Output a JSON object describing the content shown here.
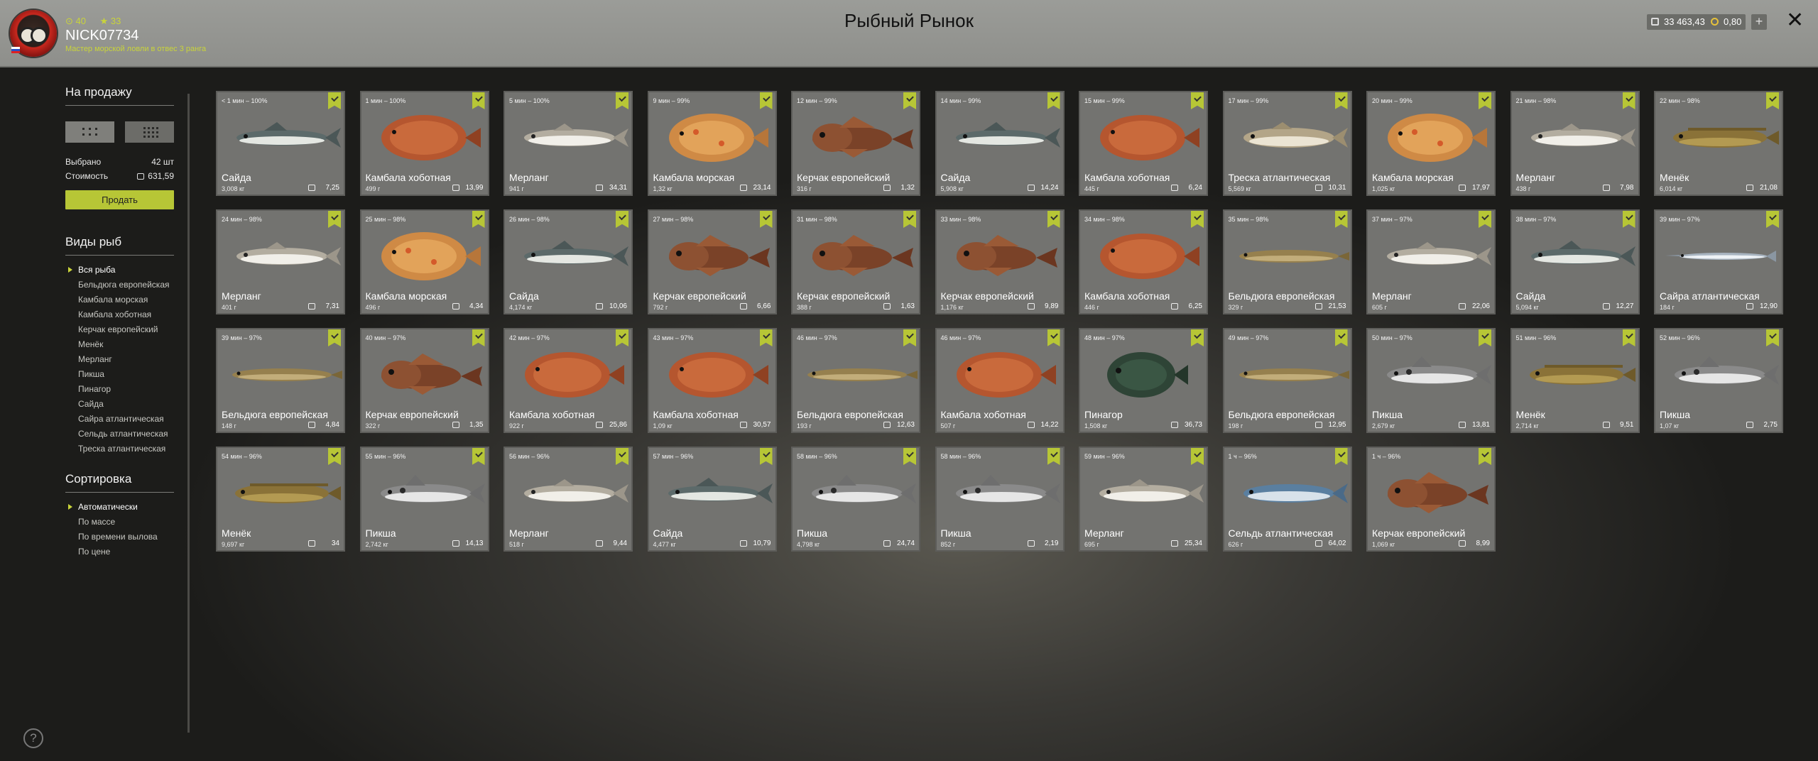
{
  "header": {
    "title": "Рыбный Рынок",
    "player": {
      "nick": "NICK07734",
      "rank": "Мастер морской ловли в отвес 3 ранга",
      "stat1": "40",
      "stat2": "33"
    },
    "silver": "33 463,43",
    "gold": "0,80",
    "plus_label": "+",
    "close_label": "✕"
  },
  "sidebar": {
    "for_sale_title": "На продажу",
    "selected_label": "Выбрано",
    "selected_value": "42 шт",
    "cost_label": "Стоимость",
    "cost_value": "631,59",
    "sell_button": "Продать",
    "species_title": "Виды рыб",
    "species": [
      "Вся рыба",
      "Бельдюга европейская",
      "Камбала морская",
      "Камбала хоботная",
      "Керчак европейский",
      "Менёк",
      "Мерланг",
      "Пикша",
      "Пинагор",
      "Сайда",
      "Сайра атлантическая",
      "Сельдь атлантическая",
      "Треска атлантическая"
    ],
    "sort_title": "Сортировка",
    "sort": [
      "Автоматически",
      "По массе",
      "По времени вылова",
      "По цене"
    ],
    "help_label": "?"
  },
  "colors": {
    "accent": "#b7c636",
    "header": "#9b9c98",
    "card": "#737370"
  },
  "fish": [
    {
      "time": "< 1 мин – 100%",
      "name": "Сайда",
      "weight": "3,008 кг",
      "price": "7,25",
      "kind": "pollock"
    },
    {
      "time": "1 мин – 100%",
      "name": "Камбала хоботная",
      "weight": "499 г",
      "price": "13,99",
      "kind": "flatfish"
    },
    {
      "time": "5 мин – 100%",
      "name": "Мерланг",
      "weight": "941 г",
      "price": "34,31",
      "kind": "whiting"
    },
    {
      "time": "9 мин – 99%",
      "name": "Камбала морская",
      "weight": "1,32 кг",
      "price": "23,14",
      "kind": "plaice"
    },
    {
      "time": "12 мин – 99%",
      "name": "Керчак европейский",
      "weight": "316 г",
      "price": "1,32",
      "kind": "sculpin"
    },
    {
      "time": "14 мин – 99%",
      "name": "Сайда",
      "weight": "5,908 кг",
      "price": "14,24",
      "kind": "pollock"
    },
    {
      "time": "15 мин – 99%",
      "name": "Камбала хоботная",
      "weight": "445 г",
      "price": "6,24",
      "kind": "flatfish"
    },
    {
      "time": "17 мин – 99%",
      "name": "Треска атлантическая",
      "weight": "5,569 кг",
      "price": "10,31",
      "kind": "cod"
    },
    {
      "time": "20 мин – 99%",
      "name": "Камбала морская",
      "weight": "1,025 кг",
      "price": "17,97",
      "kind": "plaice"
    },
    {
      "time": "21 мин – 98%",
      "name": "Мерланг",
      "weight": "438 г",
      "price": "7,98",
      "kind": "whiting"
    },
    {
      "time": "22 мин – 98%",
      "name": "Менёк",
      "weight": "6,014 кг",
      "price": "21,08",
      "kind": "tusk"
    },
    {
      "time": "24 мин – 98%",
      "name": "Мерланг",
      "weight": "401 г",
      "price": "7,31",
      "kind": "whiting"
    },
    {
      "time": "25 мин – 98%",
      "name": "Камбала морская",
      "weight": "496 г",
      "price": "4,34",
      "kind": "plaice"
    },
    {
      "time": "26 мин – 98%",
      "name": "Сайда",
      "weight": "4,174 кг",
      "price": "10,06",
      "kind": "pollock"
    },
    {
      "time": "27 мин – 98%",
      "name": "Керчак европейский",
      "weight": "792 г",
      "price": "6,66",
      "kind": "sculpin"
    },
    {
      "time": "31 мин – 98%",
      "name": "Керчак европейский",
      "weight": "388 г",
      "price": "1,63",
      "kind": "sculpin"
    },
    {
      "time": "33 мин – 98%",
      "name": "Керчак европейский",
      "weight": "1,176 кг",
      "price": "9,89",
      "kind": "sculpin"
    },
    {
      "time": "34 мин – 98%",
      "name": "Камбала хоботная",
      "weight": "446 г",
      "price": "6,25",
      "kind": "flatfish"
    },
    {
      "time": "35 мин – 98%",
      "name": "Бельдюга европейская",
      "weight": "329 г",
      "price": "21,53",
      "kind": "eelpout"
    },
    {
      "time": "37 мин – 97%",
      "name": "Мерланг",
      "weight": "605 г",
      "price": "22,06",
      "kind": "whiting"
    },
    {
      "time": "38 мин – 97%",
      "name": "Сайда",
      "weight": "5,094 кг",
      "price": "12,27",
      "kind": "pollock"
    },
    {
      "time": "39 мин – 97%",
      "name": "Сайра атлантическая",
      "weight": "184 г",
      "price": "12,90",
      "kind": "saury"
    },
    {
      "time": "39 мин – 97%",
      "name": "Бельдюга европейская",
      "weight": "148 г",
      "price": "4,84",
      "kind": "eelpout"
    },
    {
      "time": "40 мин – 97%",
      "name": "Керчак европейский",
      "weight": "322 г",
      "price": "1,35",
      "kind": "sculpin"
    },
    {
      "time": "42 мин – 97%",
      "name": "Камбала хоботная",
      "weight": "922 г",
      "price": "25,86",
      "kind": "flatfish"
    },
    {
      "time": "43 мин – 97%",
      "name": "Камбала хоботная",
      "weight": "1,09 кг",
      "price": "30,57",
      "kind": "flatfish"
    },
    {
      "time": "46 мин – 97%",
      "name": "Бельдюга европейская",
      "weight": "193 г",
      "price": "12,63",
      "kind": "eelpout"
    },
    {
      "time": "46 мин – 97%",
      "name": "Камбала хоботная",
      "weight": "507 г",
      "price": "14,22",
      "kind": "flatfish"
    },
    {
      "time": "48 мин – 97%",
      "name": "Пинагор",
      "weight": "1,508 кг",
      "price": "36,73",
      "kind": "lumpfish"
    },
    {
      "time": "49 мин – 97%",
      "name": "Бельдюга европейская",
      "weight": "198 г",
      "price": "12,95",
      "kind": "eelpout"
    },
    {
      "time": "50 мин – 97%",
      "name": "Пикша",
      "weight": "2,679 кг",
      "price": "13,81",
      "kind": "haddock"
    },
    {
      "time": "51 мин – 96%",
      "name": "Менёк",
      "weight": "2,714 кг",
      "price": "9,51",
      "kind": "tusk"
    },
    {
      "time": "52 мин – 96%",
      "name": "Пикша",
      "weight": "1,07 кг",
      "price": "2,75",
      "kind": "haddock"
    },
    {
      "time": "54 мин – 96%",
      "name": "Менёк",
      "weight": "9,697 кг",
      "price": "34",
      "kind": "tusk"
    },
    {
      "time": "55 мин – 96%",
      "name": "Пикша",
      "weight": "2,742 кг",
      "price": "14,13",
      "kind": "haddock"
    },
    {
      "time": "56 мин – 96%",
      "name": "Мерланг",
      "weight": "518 г",
      "price": "9,44",
      "kind": "whiting"
    },
    {
      "time": "57 мин – 96%",
      "name": "Сайда",
      "weight": "4,477 кг",
      "price": "10,79",
      "kind": "pollock"
    },
    {
      "time": "58 мин – 96%",
      "name": "Пикша",
      "weight": "4,798 кг",
      "price": "24,74",
      "kind": "haddock"
    },
    {
      "time": "58 мин – 96%",
      "name": "Пикша",
      "weight": "852 г",
      "price": "2,19",
      "kind": "haddock"
    },
    {
      "time": "59 мин – 96%",
      "name": "Мерланг",
      "weight": "695 г",
      "price": "25,34",
      "kind": "whiting"
    },
    {
      "time": "1 ч – 96%",
      "name": "Сельдь атлантическая",
      "weight": "626 г",
      "price": "64,02",
      "kind": "herring"
    },
    {
      "time": "1 ч – 96%",
      "name": "Керчак европейский",
      "weight": "1,069 кг",
      "price": "8,99",
      "kind": "sculpin"
    }
  ]
}
